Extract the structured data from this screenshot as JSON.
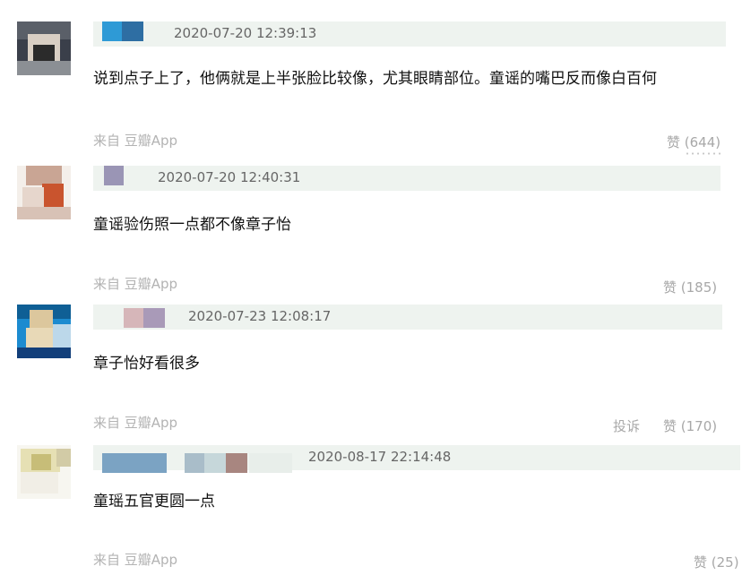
{
  "comments": [
    {
      "timestamp": "2020-07-20 12:39:13",
      "text": "说到点子上了，他俩就是上半张脸比较像，尤其眼睛部位。童谣的嘴巴反而像白百何",
      "source": "来自 豆瓣App",
      "like": "赞 (644)"
    },
    {
      "timestamp": "2020-07-20 12:40:31",
      "text": "童谣验伤照一点都不像章子怡",
      "source": "来自 豆瓣App",
      "like": "赞 (185)"
    },
    {
      "timestamp": "2020-07-23 12:08:17",
      "text": "章子怡好看很多",
      "source": "来自 豆瓣App",
      "report": "投诉",
      "like": "赞 (170)"
    },
    {
      "timestamp": "2020-08-17 22:14:48",
      "text": "童瑶五官更圆一点",
      "source": "来自 豆瓣App",
      "like": "赞 (25)"
    }
  ],
  "colors": {
    "header_bar": "#eef3ef",
    "source_text": "#b3b3b3",
    "like_text": "#a8a8a8",
    "timestamp_text": "#666666"
  }
}
